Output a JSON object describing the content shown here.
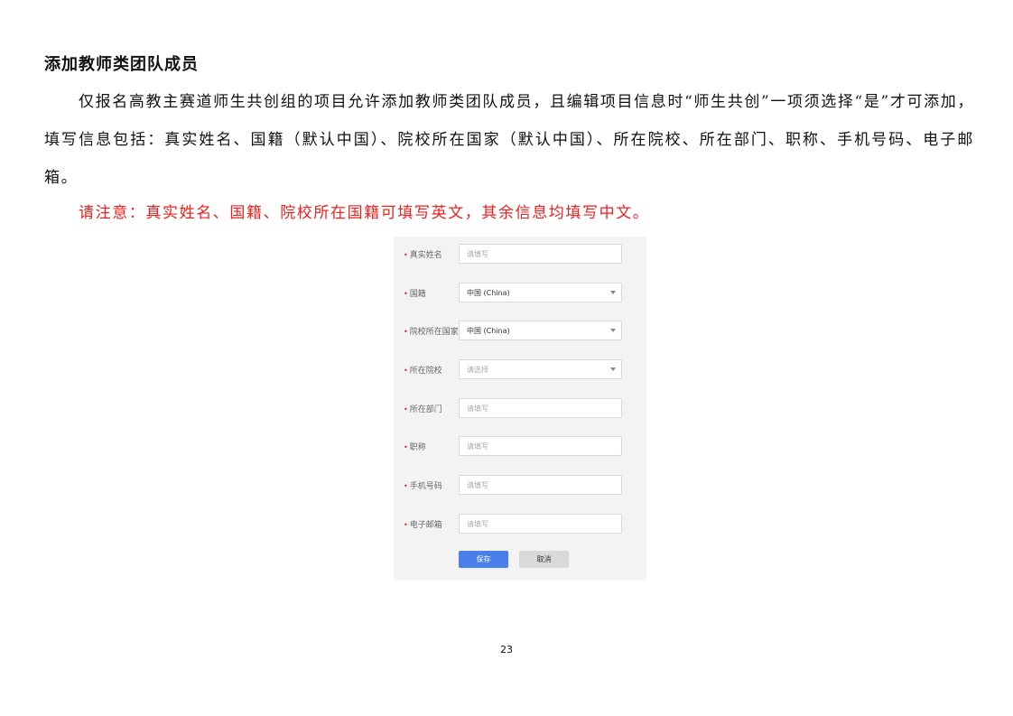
{
  "document": {
    "heading": "添加教师类团队成员",
    "paragraph": "仅报名高教主赛道师生共创组的项目允许添加教师类团队成员，且编辑项目信息时“师生共创”一项须选择“是”才可添加，填写信息包括：真实姓名、国籍（默认中国）、院校所在国家（默认中国）、所在院校、所在部门、职称、手机号码、电子邮箱。",
    "note": "请注意：真实姓名、国籍、院校所在国籍可填写英文，其余信息均填写中文。",
    "page_number": "23"
  },
  "form": {
    "required_mark": "•",
    "fields": [
      {
        "label": "真实姓名",
        "placeholder": "请填写",
        "value": ""
      },
      {
        "label": "国籍",
        "placeholder": "",
        "value": "中国 (China)"
      },
      {
        "label": "院校所在国家",
        "placeholder": "",
        "value": "中国 (China)"
      },
      {
        "label": "所在院校",
        "placeholder": "请选择",
        "value": ""
      },
      {
        "label": "所在部门",
        "placeholder": "请填写",
        "value": ""
      },
      {
        "label": "职称",
        "placeholder": "请填写",
        "value": ""
      },
      {
        "label": "手机号码",
        "placeholder": "请填写",
        "value": ""
      },
      {
        "label": "电子邮箱",
        "placeholder": "请填写",
        "value": ""
      }
    ],
    "save_label": "保存",
    "cancel_label": "取消"
  }
}
